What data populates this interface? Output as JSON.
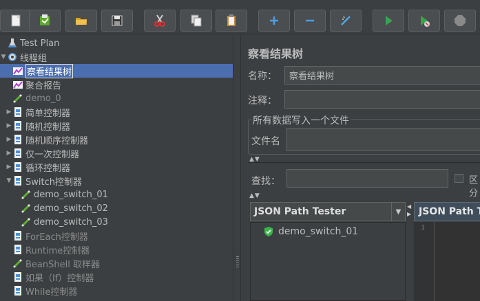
{
  "toolbar": {
    "buttons": [
      {
        "name": "new",
        "icon": "new-file-icon"
      },
      {
        "name": "templates",
        "icon": "templates-icon"
      },
      {
        "name": "open",
        "icon": "open-folder-icon"
      },
      {
        "name": "save",
        "icon": "save-icon"
      },
      {
        "name": "cut",
        "icon": "scissors-icon"
      },
      {
        "name": "copy",
        "icon": "copy-icon"
      },
      {
        "name": "paste",
        "icon": "clipboard-icon"
      },
      {
        "name": "expand",
        "icon": "plus-icon"
      },
      {
        "name": "collapse",
        "icon": "minus-icon"
      },
      {
        "name": "toggle",
        "icon": "wand-icon"
      },
      {
        "name": "start",
        "icon": "play-icon"
      },
      {
        "name": "start-no-pauses",
        "icon": "play-no-pauses-icon"
      },
      {
        "name": "stop",
        "icon": "stop-icon"
      }
    ]
  },
  "tree": {
    "nodes": [
      {
        "label": "Test Plan",
        "icon": "flask-icon",
        "depth": 0,
        "expander": ""
      },
      {
        "label": "线程组",
        "icon": "gear-icon",
        "depth": 0,
        "expander": "▼"
      },
      {
        "label": "察看结果树",
        "icon": "listener-graph-icon",
        "depth": 1,
        "expander": "",
        "selected": true
      },
      {
        "label": "聚合报告",
        "icon": "listener-graph-icon",
        "depth": 1,
        "expander": ""
      },
      {
        "label": "demo_0",
        "icon": "pipette-icon",
        "depth": 1,
        "expander": "",
        "disabled": true
      },
      {
        "label": "简单控制器",
        "icon": "controller-icon",
        "depth": 1,
        "expander": "▶"
      },
      {
        "label": "随机控制器",
        "icon": "controller-icon",
        "depth": 1,
        "expander": "▶"
      },
      {
        "label": "随机顺序控制器",
        "icon": "controller-icon",
        "depth": 1,
        "expander": "▶"
      },
      {
        "label": "仅一次控制器",
        "icon": "controller-icon",
        "depth": 1,
        "expander": "▶"
      },
      {
        "label": "循环控制器",
        "icon": "controller-icon",
        "depth": 1,
        "expander": "▶"
      },
      {
        "label": "Switch控制器",
        "icon": "controller-icon",
        "depth": 1,
        "expander": "▼"
      },
      {
        "label": "demo_switch_01",
        "icon": "pipette-icon",
        "depth": 2,
        "expander": ""
      },
      {
        "label": "demo_switch_02",
        "icon": "pipette-icon",
        "depth": 2,
        "expander": ""
      },
      {
        "label": "demo_switch_03",
        "icon": "pipette-icon",
        "depth": 2,
        "expander": ""
      },
      {
        "label": "ForEach控制器",
        "icon": "controller-icon",
        "depth": 1,
        "expander": "",
        "disabled": true
      },
      {
        "label": "Runtime控制器",
        "icon": "controller-icon",
        "depth": 1,
        "expander": "",
        "disabled": true
      },
      {
        "label": "BeanShell 取样器",
        "icon": "pipette-icon",
        "depth": 1,
        "expander": "",
        "disabled": true
      },
      {
        "label": "如果（If）控制器",
        "icon": "controller-icon",
        "depth": 1,
        "expander": "",
        "disabled": true
      },
      {
        "label": "While控制器",
        "icon": "controller-icon",
        "depth": 1,
        "expander": "",
        "disabled": true
      }
    ]
  },
  "panel": {
    "title": "察看结果树",
    "name_label": "名称：",
    "name_value": "察看结果树",
    "comment_label": "注释：",
    "comment_value": "",
    "file_group_title": "所有数据写入一个文件",
    "filename_label": "文件名",
    "filename_value": "",
    "search_label": "查找：",
    "search_value": "",
    "case_label": "区分",
    "renderer_selected": "JSON Path Tester",
    "results": [
      {
        "label": "demo_switch_01",
        "status": "success-shield-icon"
      }
    ],
    "tester_tab": "JSON Path Te",
    "line_number": "1"
  },
  "colors": {
    "background": "#3c3f41",
    "selection": "#4b6eaf",
    "success": "#3bb54a"
  }
}
